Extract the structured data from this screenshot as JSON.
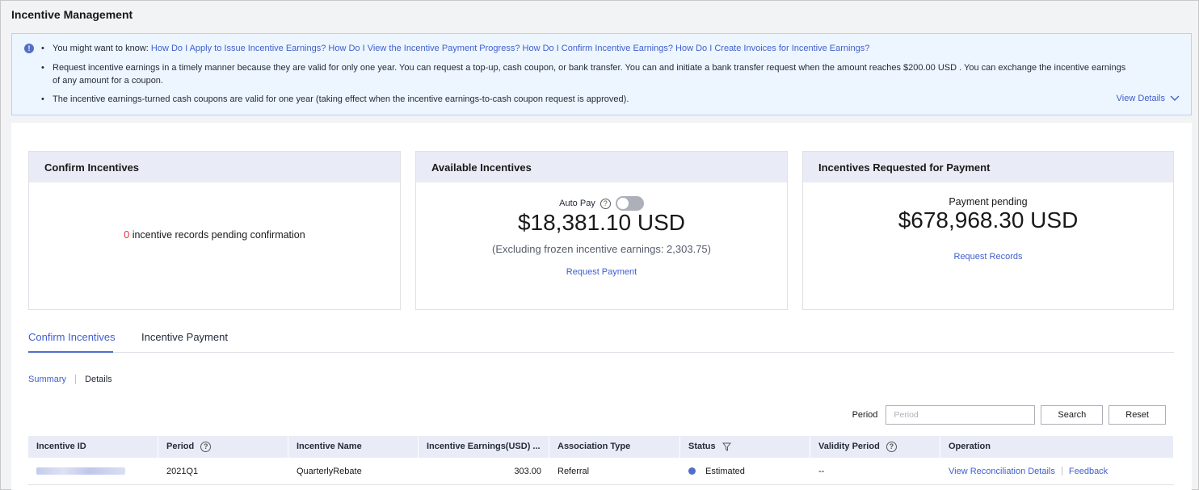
{
  "page_title": "Incentive Management",
  "notice": {
    "intro": "You might want to know:",
    "links": [
      "How Do I Apply to Issue Incentive Earnings?",
      "How Do I View the Incentive Payment Progress?",
      "How Do I Confirm Incentive Earnings?",
      "How Do I Create Invoices for Incentive Earnings?"
    ],
    "line2a": "Request incentive earnings in a timely manner because they are valid for only one year. You can request a top-up, cash coupon, or bank transfer. You can and initiate a bank transfer request when the amount reaches $200.00 USD . You can exchange the incentive earnings",
    "line2b": "of any amount for a coupon.",
    "line3": "The incentive earnings-turned cash coupons are valid for one year (taking effect when the incentive earnings-to-cash coupon request is approved).",
    "view_details": "View Details"
  },
  "cards": {
    "confirm": {
      "title": "Confirm Incentives",
      "count": "0",
      "text": "incentive records pending confirmation"
    },
    "available": {
      "title": "Available Incentives",
      "auto_pay": "Auto Pay",
      "amount": "$18,381.10 USD",
      "frozen": "(Excluding frozen incentive earnings: 2,303.75)",
      "link": "Request Payment"
    },
    "requested": {
      "title": "Incentives Requested for Payment",
      "label": "Payment pending",
      "amount": "$678,968.30 USD",
      "link": "Request Records"
    }
  },
  "tabs": [
    "Confirm Incentives",
    "Incentive Payment"
  ],
  "subnav": [
    "Summary",
    "Details"
  ],
  "filter": {
    "label": "Period",
    "placeholder": "Period",
    "search": "Search",
    "reset": "Reset"
  },
  "table": {
    "headers": [
      "Incentive ID",
      "Period",
      "Incentive Name",
      "Incentive Earnings(USD) ...",
      "Association Type",
      "Status",
      "Validity Period",
      "Operation"
    ],
    "rows": [
      {
        "period": "2021Q1",
        "name": "QuarterlyRebate",
        "earnings": "303.00",
        "association": "Referral",
        "status": "Estimated",
        "validity": "--",
        "op1": "View Reconciliation Details",
        "op2": "Feedback"
      }
    ]
  },
  "colors": {
    "accent": "#526ecc",
    "link": "#3f5fcc",
    "alert_red": "#e23131",
    "header_bg": "#e9ecf6"
  }
}
